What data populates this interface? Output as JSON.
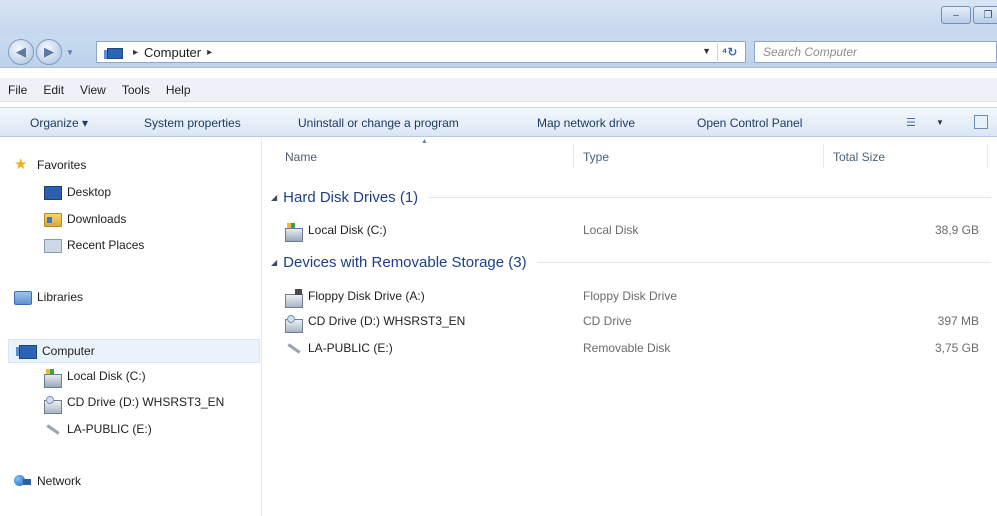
{
  "window": {
    "minimize_glyph": "–",
    "maximize_glyph": "❐"
  },
  "address": {
    "crumbs": [
      "Computer"
    ],
    "search_placeholder": "Search Computer"
  },
  "menubar": {
    "items": [
      "File",
      "Edit",
      "View",
      "Tools",
      "Help"
    ]
  },
  "toolbar": {
    "organize": "Organize ▾",
    "system_properties": "System properties",
    "uninstall": "Uninstall or change a program",
    "map_drive": "Map network drive",
    "control_panel": "Open Control Panel"
  },
  "sidebar": {
    "favorites": "Favorites",
    "desktop": "Desktop",
    "downloads": "Downloads",
    "recent": "Recent Places",
    "libraries": "Libraries",
    "computer": "Computer",
    "local_disk": "Local Disk (C:)",
    "cd_drive": "CD Drive (D:) WHSRST3_EN",
    "la_public": "LA-PUBLIC (E:)",
    "network": "Network"
  },
  "columns": {
    "name": "Name",
    "type": "Type",
    "total_size": "Total Size"
  },
  "groups": {
    "hdd": {
      "title": "Hard Disk Drives (1)",
      "items": [
        {
          "name": "Local Disk (C:)",
          "type": "Local Disk",
          "size": "38,9 GB"
        }
      ]
    },
    "removable": {
      "title": "Devices with Removable Storage (3)",
      "items": [
        {
          "name": "Floppy Disk Drive (A:)",
          "type": "Floppy Disk Drive",
          "size": ""
        },
        {
          "name": "CD Drive (D:) WHSRST3_EN",
          "type": "CD Drive",
          "size": "397 MB"
        },
        {
          "name": "LA-PUBLIC (E:)",
          "type": "Removable Disk",
          "size": "3,75 GB"
        }
      ]
    }
  }
}
